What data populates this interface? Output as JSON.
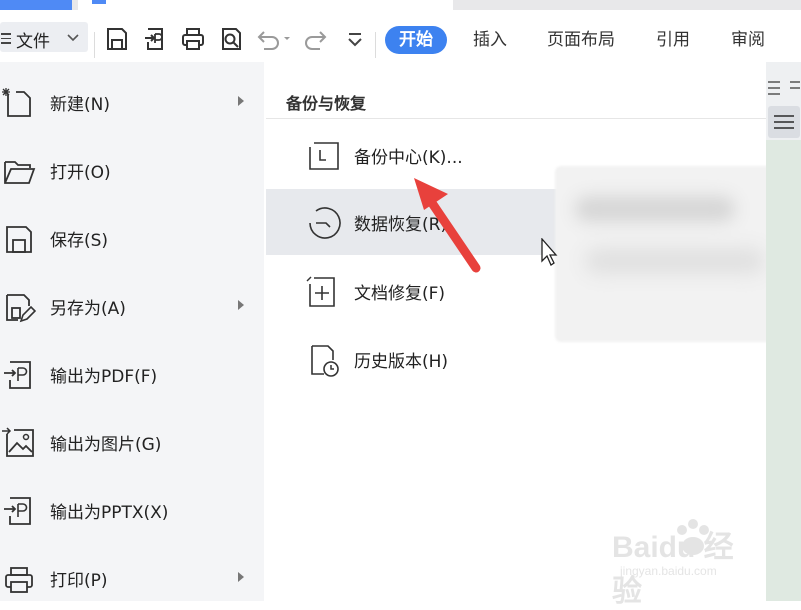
{
  "toolbar": {
    "file_menu_label": "文件",
    "tabs": [
      {
        "label": "开始",
        "active": true
      },
      {
        "label": "插入",
        "active": false
      },
      {
        "label": "页面布局",
        "active": false
      },
      {
        "label": "引用",
        "active": false
      },
      {
        "label": "审阅",
        "active": false
      }
    ],
    "icons": [
      "save-icon",
      "export-pdf-icon",
      "print-icon",
      "print-preview-icon",
      "undo-icon",
      "redo-icon",
      "more-dropdown-icon"
    ]
  },
  "file_menu": {
    "items": [
      {
        "label": "新建(N)",
        "icon": "new-file-icon",
        "has_submenu": true
      },
      {
        "label": "打开(O)",
        "icon": "open-folder-icon",
        "has_submenu": false
      },
      {
        "label": "保存(S)",
        "icon": "save-icon",
        "has_submenu": false
      },
      {
        "label": "另存为(A)",
        "icon": "save-as-icon",
        "has_submenu": true
      },
      {
        "label": "输出为PDF(F)",
        "icon": "export-pdf-icon",
        "has_submenu": false
      },
      {
        "label": "输出为图片(G)",
        "icon": "export-image-icon",
        "has_submenu": false
      },
      {
        "label": "输出为PPTX(X)",
        "icon": "export-pptx-icon",
        "has_submenu": false
      },
      {
        "label": "打印(P)",
        "icon": "print-icon",
        "has_submenu": true
      }
    ]
  },
  "submenu": {
    "title": "备份与恢复",
    "items": [
      {
        "label": "备份中心(K)...",
        "icon": "backup-center-icon",
        "highlighted": false
      },
      {
        "label": "数据恢复(R)",
        "icon": "data-recovery-icon",
        "highlighted": true
      },
      {
        "label": "文档修复(F)",
        "icon": "document-repair-icon",
        "highlighted": false
      },
      {
        "label": "历史版本(H)",
        "icon": "history-version-icon",
        "highlighted": false
      }
    ]
  },
  "watermark": {
    "brand": "Baidu 经验",
    "url": "jingyan.baidu.com"
  },
  "colors": {
    "accent": "#3d82f0",
    "annotation_arrow": "#e8413c"
  }
}
